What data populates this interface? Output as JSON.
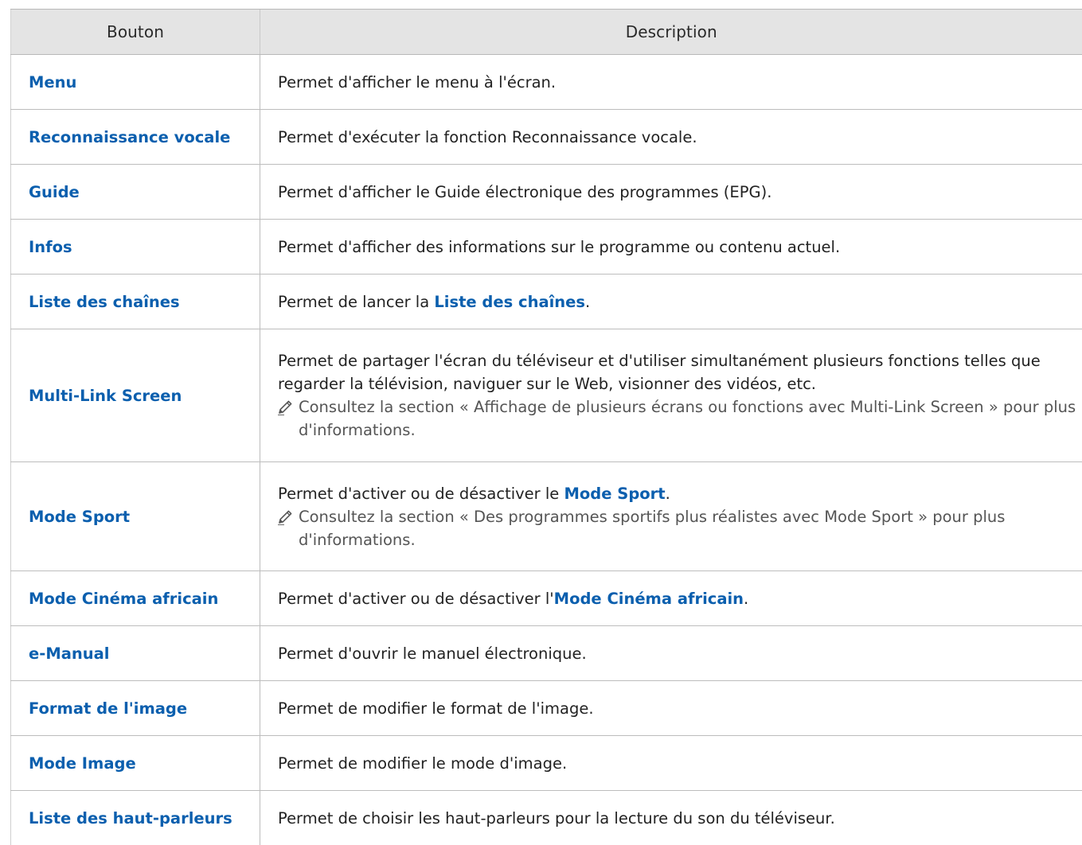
{
  "table": {
    "headers": {
      "button": "Bouton",
      "description": "Description"
    },
    "rows": {
      "menu": {
        "button": "Menu",
        "desc": "Permet d'afficher le menu à l'écran."
      },
      "voice": {
        "button": "Reconnaissance vocale",
        "desc": "Permet d'exécuter la fonction Reconnaissance vocale."
      },
      "guide": {
        "button": "Guide",
        "desc": "Permet d'afficher le Guide électronique des programmes (EPG)."
      },
      "infos": {
        "button": "Infos",
        "desc": "Permet d'afficher des informations sur le programme ou contenu actuel."
      },
      "channels": {
        "button": "Liste des chaînes",
        "desc_pre": "Permet de lancer la ",
        "desc_kw": "Liste des chaînes",
        "desc_post": "."
      },
      "multilink": {
        "button": "Multi-Link Screen",
        "desc": "Permet de partager l'écran du téléviseur et d'utiliser simultanément plusieurs fonctions telles que regarder la télévision, naviguer sur le Web, visionner des vidéos, etc.",
        "note": "Consultez la section « Affichage de plusieurs écrans ou fonctions avec Multi-Link Screen » pour plus d'informations."
      },
      "sport": {
        "button": "Mode Sport",
        "desc_pre": "Permet d'activer ou de désactiver le ",
        "desc_kw": "Mode Sport",
        "desc_post": ".",
        "note": "Consultez la section « Des programmes sportifs plus réalistes avec Mode Sport » pour plus d'informations."
      },
      "cinema": {
        "button": "Mode Cinéma africain",
        "desc_pre": "Permet d'activer ou de désactiver l'",
        "desc_kw": "Mode Cinéma africain",
        "desc_post": "."
      },
      "emanual": {
        "button": "e-Manual",
        "desc": "Permet d'ouvrir le manuel électronique."
      },
      "format": {
        "button": "Format de l'image",
        "desc": "Permet de modifier le format de l'image."
      },
      "image": {
        "button": "Mode Image",
        "desc": "Permet de modifier le mode d'image."
      },
      "speakers": {
        "button": "Liste des haut-parleurs",
        "desc": "Permet de choisir les haut-parleurs pour la lecture du son du téléviseur."
      }
    }
  },
  "colors": {
    "header_bg": "#e4e4e4",
    "keyword_blue": "#0b5fae",
    "text": "#222222",
    "note_text": "#555555",
    "grid": "#bdbdbd"
  },
  "icons": {
    "note": "pencil-note-icon"
  }
}
